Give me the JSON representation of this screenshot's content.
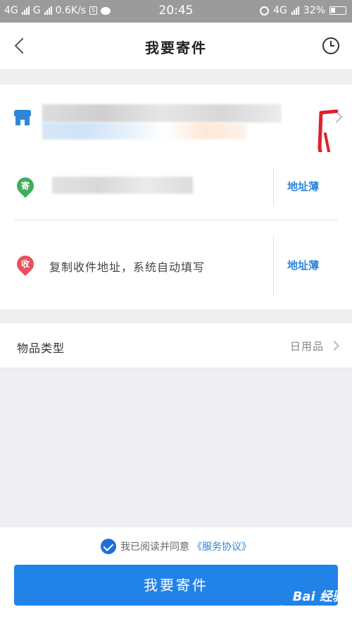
{
  "status_bar": {
    "network_1": "4G",
    "network_2": "G",
    "speed": "0.6K/s",
    "sim_badge": "S",
    "time": "20:45",
    "network_3": "4G",
    "battery": "32%"
  },
  "navbar": {
    "title": "我要寄件",
    "back_icon": "chevron-left-icon",
    "history_icon": "clock-icon"
  },
  "sender": {
    "pin_label": "寄",
    "address_book_label": "地址薄",
    "pin_color": "#3fae5a"
  },
  "receiver": {
    "pin_label": "收",
    "placeholder": "复制收件地址，系统自动填写",
    "address_book_label": "地址薄",
    "pin_color": "#e8505b"
  },
  "goods": {
    "label": "物品类型",
    "value": "日用品"
  },
  "agreement": {
    "text": "我已阅读并同意",
    "link": "《服务协议》",
    "checked": true
  },
  "submit": {
    "label": "我要寄件",
    "color": "#2183e8"
  },
  "watermark": {
    "brand": "Bai 经验",
    "url": "jingyan.baidu.com"
  },
  "colors": {
    "accent": "#2f86d8",
    "annotation": "#e0202a"
  }
}
